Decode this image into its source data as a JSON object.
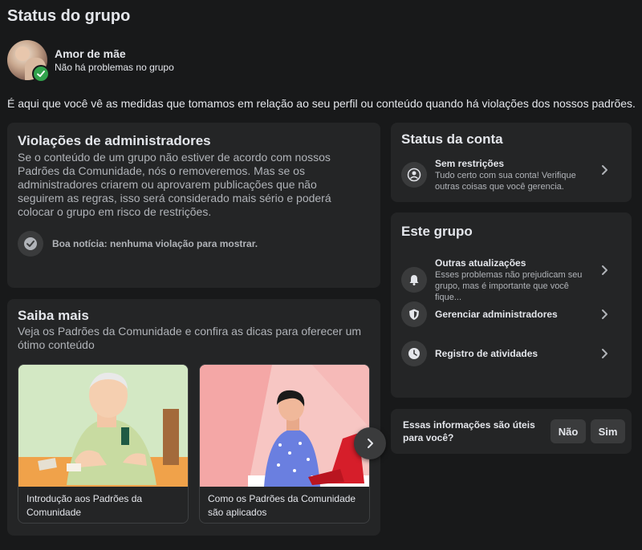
{
  "page": {
    "title": "Status do grupo",
    "intro": "É aqui que você vê as medidas que tomamos em relação ao seu perfil ou conteúdo quando há violações dos nossos padrões."
  },
  "group": {
    "name": "Amor de mãe",
    "status": "Não há problemas no grupo"
  },
  "admin_violations": {
    "title": "Violações de administradores",
    "description": "Se o conteúdo de um grupo não estiver de acordo com nossos Padrões da Comunidade, nós o removeremos. Mas se os administradores criarem ou aprovarem publicações que não seguirem as regras, isso será considerado mais sério e poderá colocar o grupo em risco de restrições.",
    "good_news": "Boa notícia: nenhuma violação para mostrar."
  },
  "learn_more": {
    "title": "Saiba mais",
    "description": "Veja os Padrões da Comunidade e confira as dicas para oferecer um ótimo conteúdo",
    "articles": [
      {
        "label": "Introdução aos Padrões da Comunidade"
      },
      {
        "label": "Como os Padrões da Comunidade são aplicados"
      }
    ]
  },
  "account_status": {
    "title": "Status da conta",
    "item_title": "Sem restrições",
    "item_sub": "Tudo certo com sua conta! Verifique outras coisas que você gerencia."
  },
  "this_group": {
    "title": "Este grupo",
    "items": [
      {
        "title": "Outras atualizações",
        "sub": "Esses problemas não prejudicam seu grupo, mas é importante que você fique...",
        "icon": "bell-icon"
      },
      {
        "title": "Gerenciar administradores",
        "sub": "",
        "icon": "shield-icon"
      },
      {
        "title": "Registro de atividades",
        "sub": "",
        "icon": "clock-icon"
      }
    ]
  },
  "feedback": {
    "question": "Essas informações são úteis para você?",
    "no": "Não",
    "yes": "Sim"
  },
  "colors": {
    "background": "#18191a",
    "card": "#242526",
    "accent_green": "#31a24c"
  }
}
